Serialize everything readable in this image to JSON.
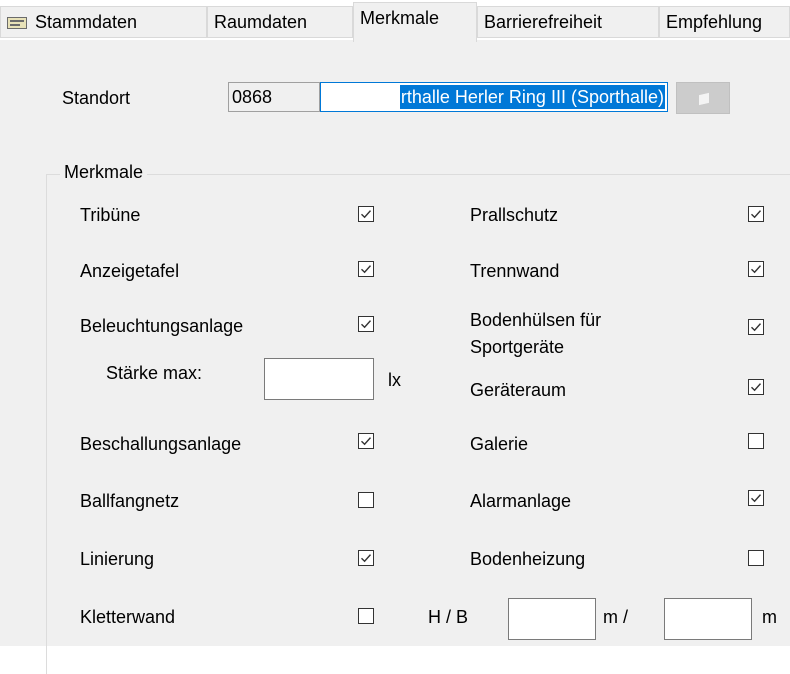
{
  "tabs": [
    {
      "label": "Stammdaten",
      "active": false,
      "icon": "table-icon"
    },
    {
      "label": "Raumdaten",
      "active": false
    },
    {
      "label": "Merkmale",
      "active": true
    },
    {
      "label": "Barrierefreiheit",
      "active": false
    },
    {
      "label": "Empfehlung",
      "active": false
    }
  ],
  "standort": {
    "label": "Standort",
    "code": "0868",
    "name": "rthalle Herler Ring III (Sporthalle)",
    "button_icon": "pick-arrow-icon"
  },
  "merkmale": {
    "title": "Merkmale",
    "left": [
      {
        "label": "Tribüne",
        "checked": true
      },
      {
        "label": "Anzeigetafel",
        "checked": true
      },
      {
        "label": "Beleuchtungsanlage",
        "checked": true
      },
      {
        "label": "Beschallungsanlage",
        "checked": true
      },
      {
        "label": "Ballfangnetz",
        "checked": false
      },
      {
        "label": "Linierung",
        "checked": true
      },
      {
        "label": "Kletterwand",
        "checked": false
      }
    ],
    "right": [
      {
        "label": "Prallschutz",
        "checked": true
      },
      {
        "label": "Trennwand",
        "checked": true
      },
      {
        "label": "Bodenhülsen für Sportgeräte",
        "checked": true
      },
      {
        "label": "Geräteraum",
        "checked": true
      },
      {
        "label": "Galerie",
        "checked": false
      },
      {
        "label": "Alarmanlage",
        "checked": true
      },
      {
        "label": "Bodenheizung",
        "checked": false
      }
    ],
    "staerke": {
      "label": "Stärke max:",
      "unit": "lx",
      "value": ""
    },
    "hb": {
      "label": "H / B",
      "unit1": "m /",
      "unit2": "m",
      "h_value": "",
      "b_value": ""
    }
  },
  "colors": {
    "selection": "#0078d7",
    "panel": "#f0f0f0"
  }
}
